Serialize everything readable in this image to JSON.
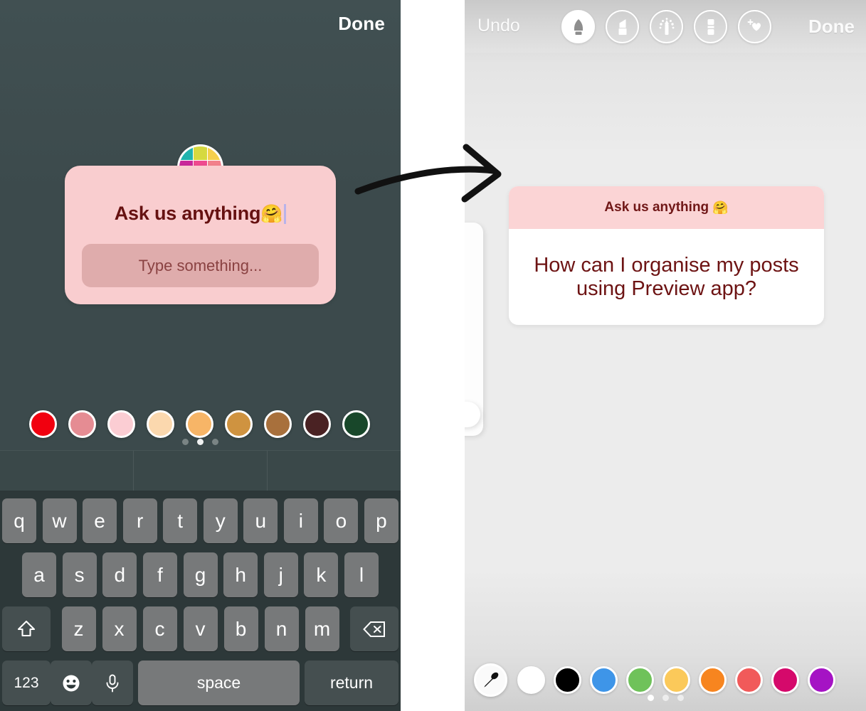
{
  "left_panel": {
    "done_label": "Done",
    "avatar": {
      "name": "profile-avatar",
      "grid_colors": [
        "#1fb3ae",
        "#d6d93f",
        "#f6cf4c",
        "#c9289a",
        "#ef4a8f",
        "#f2818c",
        "#ef7d2b",
        "#e01e3c",
        "#e8264a"
      ]
    },
    "question_sticker": {
      "prompt_text": "Ask us anything",
      "prompt_emoji": "🤗",
      "answer_placeholder": "Type something...",
      "sticker_bg": "#f9cdcf",
      "answer_box_bg": "#dfacac",
      "text_color": "#661111"
    },
    "colors": [
      {
        "name": "red",
        "hex": "#f1000f"
      },
      {
        "name": "dusty-rose",
        "hex": "#e58c93"
      },
      {
        "name": "light-pink",
        "hex": "#fbcdd3"
      },
      {
        "name": "cream",
        "hex": "#fbd8ae"
      },
      {
        "name": "peach",
        "hex": "#f7b567"
      },
      {
        "name": "tan",
        "hex": "#cf9340"
      },
      {
        "name": "brown",
        "hex": "#a8703c"
      },
      {
        "name": "dark-brown",
        "hex": "#4a2223"
      },
      {
        "name": "forest-green",
        "hex": "#18472a"
      }
    ],
    "page_dots": {
      "count": 3,
      "active_index": 1
    },
    "keyboard": {
      "suggestion_cells": 3,
      "row1": [
        "q",
        "w",
        "e",
        "r",
        "t",
        "y",
        "u",
        "i",
        "o",
        "p"
      ],
      "row2": [
        "a",
        "s",
        "d",
        "f",
        "g",
        "h",
        "j",
        "k",
        "l"
      ],
      "row3": [
        "z",
        "x",
        "c",
        "v",
        "b",
        "n",
        "m"
      ],
      "shift_icon": "shift-icon",
      "delete_icon": "delete-icon",
      "numbers_label": "123",
      "emoji_icon": "emoji-icon",
      "mic_icon": "microphone-icon",
      "space_label": "space",
      "return_label": "return"
    }
  },
  "arrow": {
    "name": "flow-arrow",
    "color": "#111111"
  },
  "right_panel": {
    "undo_label": "Undo",
    "done_label": "Done",
    "tools": [
      {
        "name": "pen-tool-icon",
        "label": "Pen",
        "selected": true
      },
      {
        "name": "marker-tool-icon",
        "label": "Marker",
        "selected": false
      },
      {
        "name": "glitter-pen-tool-icon",
        "label": "Glitter pen",
        "selected": false
      },
      {
        "name": "eraser-tool-icon",
        "label": "Eraser",
        "selected": false
      },
      {
        "name": "sticker-heart-tool-icon",
        "label": "Add sticker",
        "selected": false
      }
    ],
    "answer_card": {
      "header_text": "Ask us anything",
      "header_emoji": "🤗",
      "body_text": "How can I organise my posts using Preview app?",
      "header_bg": "#fbd4d5",
      "body_bg": "#ffffff",
      "text_color": "#6d1313"
    },
    "eyedropper": {
      "name": "eyedropper-icon"
    },
    "colors": [
      {
        "name": "white",
        "hex": "#ffffff"
      },
      {
        "name": "black",
        "hex": "#000000"
      },
      {
        "name": "blue",
        "hex": "#3e95e8"
      },
      {
        "name": "green",
        "hex": "#6fc25a"
      },
      {
        "name": "yellow",
        "hex": "#fbc95a"
      },
      {
        "name": "orange",
        "hex": "#f7851f"
      },
      {
        "name": "red",
        "hex": "#f15a5a"
      },
      {
        "name": "magenta",
        "hex": "#d5096b"
      },
      {
        "name": "purple",
        "hex": "#a513c4"
      }
    ],
    "page_dots": {
      "count": 3,
      "active_index": 0
    }
  }
}
